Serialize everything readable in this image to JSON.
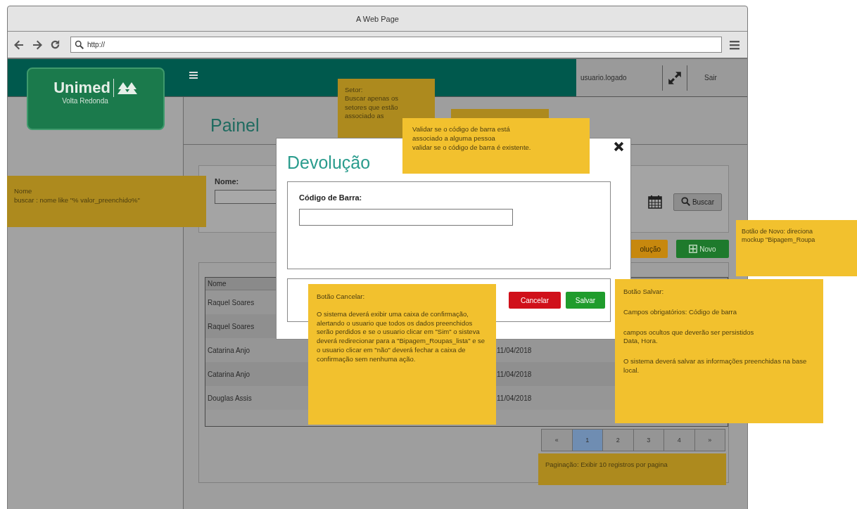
{
  "browser": {
    "title": "A Web Page",
    "url": "http://"
  },
  "header": {
    "user": "usuario.logado",
    "logout": "Sair"
  },
  "logo": {
    "name": "Unimed",
    "subtitle": "Volta Redonda"
  },
  "page": {
    "title": "Painel"
  },
  "filter": {
    "label": "Nome:",
    "search_button": "Buscar"
  },
  "actions": [
    {
      "kind": "warning",
      "label": "olução"
    },
    {
      "kind": "primary",
      "label": "Novo"
    }
  ],
  "table": {
    "columns": [
      "Nome"
    ],
    "rows": [
      {
        "name": "Raquel Soares"
      },
      {
        "name": "Raquel Soares"
      },
      {
        "name": "Catarina Anjo",
        "date": "11/04/2018"
      },
      {
        "name": "Catarina Anjo",
        "date": "11/04/2018"
      },
      {
        "name": "Douglas Assis",
        "date": "11/04/2018"
      }
    ]
  },
  "pagination": [
    {
      "label": "«",
      "selected": false
    },
    {
      "label": "1",
      "selected": true
    },
    {
      "label": "2",
      "selected": false
    },
    {
      "label": "3",
      "selected": false
    },
    {
      "label": "4",
      "selected": false
    },
    {
      "label": "»",
      "selected": false
    }
  ],
  "modal": {
    "title": "Devolução",
    "field_label": "Código de Barra:",
    "buttons": [
      {
        "kind": "cancel",
        "label": "Cancelar"
      },
      {
        "kind": "save",
        "label": "Salvar"
      }
    ]
  },
  "notes": [
    {
      "color": "#ad8a1e",
      "paragraphs": [
        "Setor:\nBuscar apenas os\nsetores que estão\nassociado as"
      ]
    },
    {
      "color": "#ad8a1e"
    },
    {
      "color": "#f2c12e",
      "paragraphs": [
        "Validar se o código de barra está\nassociado a alguma pessoa\nvalidar se o código de barra é existente."
      ]
    },
    {
      "color": "#ad8a1e",
      "paragraphs": [
        "Nome\nbuscar : nome like \"% valor_preenchido%\""
      ]
    },
    {
      "color": "#f2c12e",
      "paragraphs": [
        "Botão de Novo: direciona\nmockup \"Bipagem_Roupa"
      ]
    },
    {
      "color": "#f2c12e",
      "paragraphs": [
        "Botão Cancelar:",
        "O sistema deverá exibir uma caixa de confirmação, alertando o usuario que todos os dados preenchidos serão perdidos e se o usuario clicar em \"Sim\" o sisteva deverá redirecionar para a \"Bipagem_Roupas_lista\" e se o usuario clicar em \"não\" deverá fechar a caixa de confirmação sem nenhuma ação."
      ]
    },
    {
      "color": "#f2c12e",
      "paragraphs": [
        "Botão Salvar:",
        "Campos obrigatórios:  Código de barra",
        "campos ocultos que deverão ser persistidos\nData, Hora.",
        "O sistema deverá salvar as informações preenchidas na base local."
      ]
    },
    {
      "color": "#ad8a1e",
      "paragraphs": [
        "Paginação: Exibir 10 registros por pagina"
      ]
    }
  ]
}
